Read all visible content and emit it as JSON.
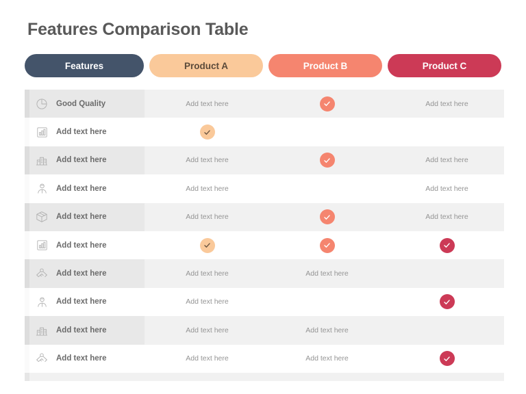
{
  "title": "Features Comparison Table",
  "colors": {
    "features_pill_bg": "#44546a",
    "features_pill_text": "#ffffff",
    "product_a_pill_bg": "#fac99a",
    "product_a_pill_text": "#5b4a3a",
    "product_b_pill_bg": "#f5856f",
    "product_b_pill_text": "#ffffff",
    "product_c_pill_bg": "#cc3a56",
    "product_c_pill_text": "#ffffff",
    "check_a_bg": "#fac99a",
    "check_a_mark": "#6b5540",
    "check_b_bg": "#f5856f",
    "check_b_mark": "#ffffff",
    "check_c_bg": "#cc3a56",
    "check_c_mark": "#ffffff",
    "row_odd_bg": "#f1f1f1",
    "row_even_bg": "#ffffff",
    "title_text": "#595959",
    "label_text": "#6b6b6b",
    "cell_text": "#949494",
    "icon_color": "#b0b0b0"
  },
  "header": {
    "columns": [
      {
        "label": "Features",
        "variant": "features"
      },
      {
        "label": "Product A",
        "variant": "a"
      },
      {
        "label": "Product B",
        "variant": "b"
      },
      {
        "label": "Product C",
        "variant": "c"
      }
    ]
  },
  "rows": [
    {
      "icon": "pie-chart-icon",
      "label": "Good Quality",
      "a": {
        "type": "text",
        "text": "Add text here"
      },
      "b": {
        "type": "check",
        "variant": "b"
      },
      "c": {
        "type": "text",
        "text": "Add text here"
      }
    },
    {
      "icon": "bar-chart-icon",
      "label": "Add text here",
      "a": {
        "type": "check",
        "variant": "a"
      },
      "b": {
        "type": "empty"
      },
      "c": {
        "type": "empty"
      }
    },
    {
      "icon": "buildings-icon",
      "label": "Add text here",
      "a": {
        "type": "text",
        "text": "Add text here"
      },
      "b": {
        "type": "check",
        "variant": "b"
      },
      "c": {
        "type": "text",
        "text": "Add text here"
      }
    },
    {
      "icon": "person-icon",
      "label": "Add text here",
      "a": {
        "type": "text",
        "text": "Add text here"
      },
      "b": {
        "type": "empty"
      },
      "c": {
        "type": "text",
        "text": "Add text here"
      }
    },
    {
      "icon": "box-icon",
      "label": "Add text here",
      "a": {
        "type": "text",
        "text": "Add text here"
      },
      "b": {
        "type": "check",
        "variant": "b"
      },
      "c": {
        "type": "text",
        "text": "Add text here"
      }
    },
    {
      "icon": "bar-chart-icon",
      "label": "Add text here",
      "a": {
        "type": "check",
        "variant": "a"
      },
      "b": {
        "type": "check",
        "variant": "b"
      },
      "c": {
        "type": "check",
        "variant": "c"
      }
    },
    {
      "icon": "handshake-icon",
      "label": "Add text here",
      "a": {
        "type": "text",
        "text": "Add text here"
      },
      "b": {
        "type": "text",
        "text": "Add text here"
      },
      "c": {
        "type": "empty"
      }
    },
    {
      "icon": "person-icon",
      "label": "Add text here",
      "a": {
        "type": "text",
        "text": "Add text here"
      },
      "b": {
        "type": "empty"
      },
      "c": {
        "type": "check",
        "variant": "c"
      }
    },
    {
      "icon": "buildings-icon",
      "label": "Add text here",
      "a": {
        "type": "text",
        "text": "Add text here"
      },
      "b": {
        "type": "text",
        "text": "Add text here"
      },
      "c": {
        "type": "empty"
      }
    },
    {
      "icon": "handshake-icon",
      "label": "Add text here",
      "a": {
        "type": "text",
        "text": "Add text here"
      },
      "b": {
        "type": "text",
        "text": "Add text here"
      },
      "c": {
        "type": "check",
        "variant": "c"
      }
    }
  ]
}
